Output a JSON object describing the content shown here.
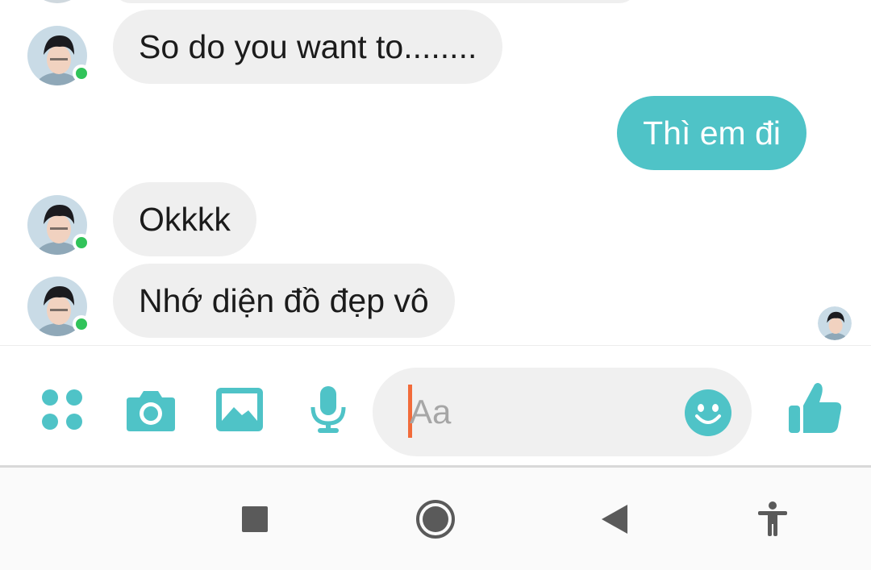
{
  "messages": [
    {
      "direction": "in",
      "text": "So do you want to........"
    },
    {
      "direction": "out",
      "text": "Thì em đi"
    },
    {
      "direction": "in",
      "text": "Okkkk"
    },
    {
      "direction": "in",
      "text": "Nhớ diện đồ đẹp vô"
    }
  ],
  "composer": {
    "placeholder": "Aa",
    "icons": [
      "apps-grid-icon",
      "camera-icon",
      "gallery-icon",
      "microphone-icon",
      "emoji-icon",
      "thumbs-up-icon"
    ]
  },
  "navigation": {
    "icons": [
      "recents-square-icon",
      "home-circle-icon",
      "back-triangle-icon",
      "accessibility-icon"
    ]
  },
  "colors": {
    "accent": "#4fc3c7",
    "incoming_bubble": "#efefef",
    "online": "#31c35a",
    "caret": "#f26b3a"
  }
}
